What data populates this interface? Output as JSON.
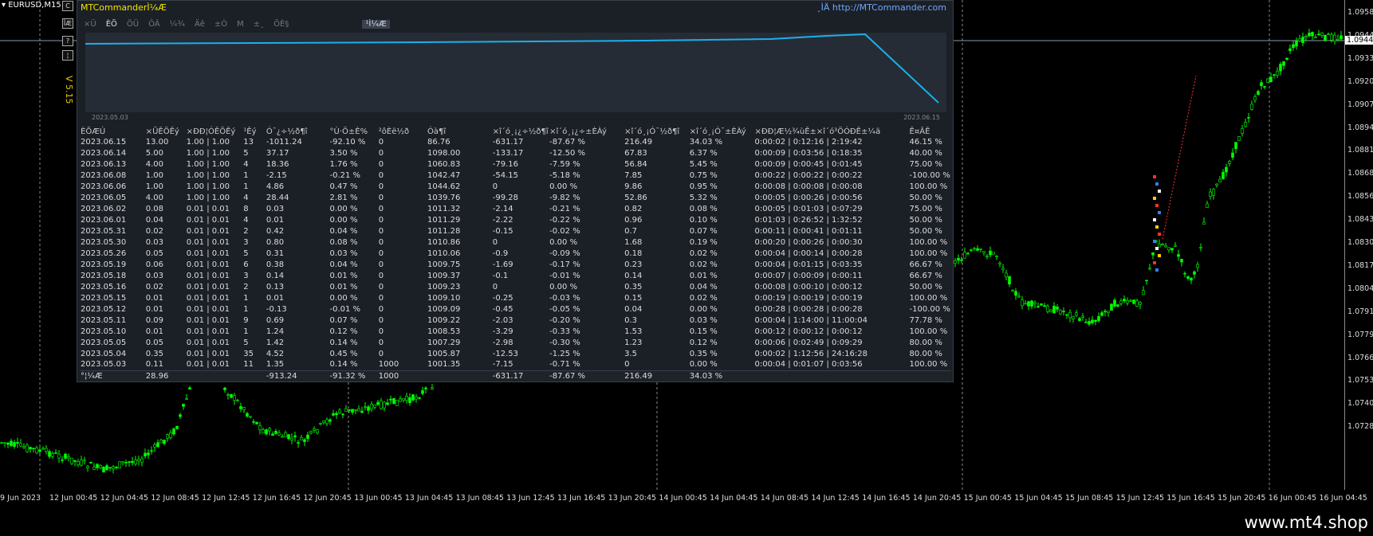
{
  "chart": {
    "symbol": "EURUSD,M15",
    "price_labels": [
      "1.09580",
      "1.09445",
      "1.09335",
      "1.09200",
      "1.09070",
      "1.08940",
      "1.08815",
      "1.08685",
      "1.08560",
      "1.08430",
      "1.08300",
      "1.08175",
      "1.08045",
      "1.07915",
      "1.07790",
      "1.07660",
      "1.07535",
      "1.07405",
      "1.07280"
    ],
    "current_price": "1.09445",
    "time_labels": [
      "9 Jun 2023",
      "12 Jun 00:45",
      "12 Jun 04:45",
      "12 Jun 08:45",
      "12 Jun 12:45",
      "12 Jun 16:45",
      "12 Jun 20:45",
      "13 Jun 00:45",
      "13 Jun 04:45",
      "13 Jun 08:45",
      "13 Jun 12:45",
      "13 Jun 16:45",
      "13 Jun 20:45",
      "14 Jun 00:45",
      "14 Jun 04:45",
      "14 Jun 08:45",
      "14 Jun 12:45",
      "14 Jun 16:45",
      "14 Jun 20:45",
      "15 Jun 00:45",
      "15 Jun 04:45",
      "15 Jun 08:45",
      "15 Jun 12:45",
      "15 Jun 16:45",
      "15 Jun 20:45",
      "16 Jun 00:45",
      "16 Jun 04:45"
    ],
    "candle_color": "#00ff00",
    "current_line_color": "#8a9aaa"
  },
  "sidebar": [
    "C",
    "ÎÆ",
    "?",
    "¦"
  ],
  "panel": {
    "title": "MTCommanderÌ¼Æ",
    "link": "¸ÌÄ http://MTCommander.com",
    "version": "V 5.15",
    "mini_start": "2023.05.03",
    "mini_end": "2023.06.15",
    "mini_color": "#1ab0ee",
    "toolbar": [
      "×Ü",
      "ÈÕ",
      "ÖÜ",
      "ÔÂ",
      "¼¾",
      "Äê",
      "±Ò",
      "M",
      "±¸",
      "ÕÈ§",
      "¹Ì¼Æ"
    ],
    "toolbar_active": 1,
    "toolbar_selected": 10
  },
  "table": {
    "headers": [
      "ÈÕÆÚ",
      "×ÜÊÖÊý",
      "×ÐÐ¦ÓÊÖÊý",
      "¹Êý",
      "Ó¯¿÷½ð¶î",
      "°Ù·Ö±È%",
      "²ôÈë½ð",
      "Óà¶î",
      "×î´ó¸¡¿÷½ð¶î",
      "×î´ó¸¡¿÷±ÈÀý",
      "×î´ó¸¡Ó¯½ð¶î",
      "×î´ó¸¡Ó¯±ÈÀý",
      "×ÐÐ¦Æ½¾ùÊ±×î´ó³ÖÓÐÊ±¼ä",
      "Ê¤ÂÊ"
    ],
    "rows": [
      [
        [
          "2023.06.15",
          ""
        ],
        [
          "13.00",
          "g"
        ],
        [
          "1.00 | 1.00",
          "g"
        ],
        [
          "13",
          "g"
        ],
        [
          "-1011.24",
          "g"
        ],
        [
          "-92.10 %",
          "g"
        ],
        [
          "0",
          ""
        ],
        [
          "86.76",
          ""
        ],
        [
          "-631.17",
          "g"
        ],
        [
          "-87.67 %",
          "g"
        ],
        [
          "216.49",
          "r"
        ],
        [
          "34.03 %",
          "r"
        ],
        [
          "0:00:02 | 0:12:16 | 2:19:42",
          ""
        ],
        [
          "46.15 %",
          ""
        ]
      ],
      [
        [
          "2023.06.14",
          ""
        ],
        [
          "5.00",
          "r"
        ],
        [
          "1.00 | 1.00",
          "r"
        ],
        [
          "5",
          "r"
        ],
        [
          "37.17",
          "r"
        ],
        [
          "3.50 %",
          "r"
        ],
        [
          "0",
          ""
        ],
        [
          "1098.00",
          ""
        ],
        [
          "-133.17",
          "g"
        ],
        [
          "-12.50 %",
          "g"
        ],
        [
          "67.83",
          "r"
        ],
        [
          "6.37 %",
          "r"
        ],
        [
          "0:00:09 | 0:03:56 | 0:18:35",
          ""
        ],
        [
          "40.00 %",
          ""
        ]
      ],
      [
        [
          "2023.06.13",
          ""
        ],
        [
          "4.00",
          "r"
        ],
        [
          "1.00 | 1.00",
          "r"
        ],
        [
          "4",
          "r"
        ],
        [
          "18.36",
          "r"
        ],
        [
          "1.76 %",
          "r"
        ],
        [
          "0",
          ""
        ],
        [
          "1060.83",
          ""
        ],
        [
          "-79.16",
          "g"
        ],
        [
          "-7.59 %",
          "g"
        ],
        [
          "56.84",
          "r"
        ],
        [
          "5.45 %",
          "r"
        ],
        [
          "0:00:09 | 0:00:45 | 0:01:45",
          ""
        ],
        [
          "75.00 %",
          ""
        ]
      ],
      [
        [
          "2023.06.08",
          ""
        ],
        [
          "1.00",
          "g"
        ],
        [
          "1.00 | 1.00",
          "g"
        ],
        [
          "1",
          "g"
        ],
        [
          "-2.15",
          "g"
        ],
        [
          "-0.21 %",
          "g"
        ],
        [
          "0",
          ""
        ],
        [
          "1042.47",
          ""
        ],
        [
          "-54.15",
          "g"
        ],
        [
          "-5.18 %",
          "g"
        ],
        [
          "7.85",
          "r"
        ],
        [
          "0.75 %",
          "r"
        ],
        [
          "0:00:22 | 0:00:22 | 0:00:22",
          ""
        ],
        [
          "-100.00 %",
          ""
        ]
      ],
      [
        [
          "2023.06.06",
          ""
        ],
        [
          "1.00",
          "r"
        ],
        [
          "1.00 | 1.00",
          "r"
        ],
        [
          "1",
          "r"
        ],
        [
          "4.86",
          "r"
        ],
        [
          "0.47 %",
          "r"
        ],
        [
          "0",
          ""
        ],
        [
          "1044.62",
          ""
        ],
        [
          "0",
          ""
        ],
        [
          "0.00 %",
          ""
        ],
        [
          "9.86",
          "r"
        ],
        [
          "0.95 %",
          "r"
        ],
        [
          "0:00:08 | 0:00:08 | 0:00:08",
          ""
        ],
        [
          "100.00 %",
          ""
        ]
      ],
      [
        [
          "2023.06.05",
          ""
        ],
        [
          "4.00",
          "r"
        ],
        [
          "1.00 | 1.00",
          "r"
        ],
        [
          "4",
          "r"
        ],
        [
          "28.44",
          "r"
        ],
        [
          "2.81 %",
          "r"
        ],
        [
          "0",
          ""
        ],
        [
          "1039.76",
          ""
        ],
        [
          "-99.28",
          "g"
        ],
        [
          "-9.82 %",
          "g"
        ],
        [
          "52.86",
          "r"
        ],
        [
          "5.32 %",
          "r"
        ],
        [
          "0:00:05 | 0:00:26 | 0:00:56",
          ""
        ],
        [
          "50.00 %",
          ""
        ]
      ],
      [
        [
          "2023.06.02",
          ""
        ],
        [
          "0.08",
          "r"
        ],
        [
          "0.01 | 0.01",
          "r"
        ],
        [
          "8",
          "r"
        ],
        [
          "0.03",
          "r"
        ],
        [
          "0.00 %",
          "r"
        ],
        [
          "0",
          ""
        ],
        [
          "1011.32",
          ""
        ],
        [
          "-2.14",
          "g"
        ],
        [
          "-0.21 %",
          "g"
        ],
        [
          "0.82",
          "r"
        ],
        [
          "0.08 %",
          "r"
        ],
        [
          "0:00:05 | 0:01:03 | 0:07:29",
          ""
        ],
        [
          "75.00 %",
          ""
        ]
      ],
      [
        [
          "2023.06.01",
          ""
        ],
        [
          "0.04",
          "r"
        ],
        [
          "0.01 | 0.01",
          "r"
        ],
        [
          "4",
          "r"
        ],
        [
          "0.01",
          "r"
        ],
        [
          "0.00 %",
          "r"
        ],
        [
          "0",
          ""
        ],
        [
          "1011.29",
          ""
        ],
        [
          "-2.22",
          "g"
        ],
        [
          "-0.22 %",
          "g"
        ],
        [
          "0.96",
          "r"
        ],
        [
          "0.10 %",
          "r"
        ],
        [
          "0:01:03 | 0:26:52 | 1:32:52",
          ""
        ],
        [
          "50.00 %",
          ""
        ]
      ],
      [
        [
          "2023.05.31",
          ""
        ],
        [
          "0.02",
          "r"
        ],
        [
          "0.01 | 0.01",
          "r"
        ],
        [
          "2",
          "r"
        ],
        [
          "0.42",
          "r"
        ],
        [
          "0.04 %",
          "r"
        ],
        [
          "0",
          ""
        ],
        [
          "1011.28",
          ""
        ],
        [
          "-0.15",
          "g"
        ],
        [
          "-0.02 %",
          "g"
        ],
        [
          "0.7",
          "r"
        ],
        [
          "0.07 %",
          "r"
        ],
        [
          "0:00:11 | 0:00:41 | 0:01:11",
          ""
        ],
        [
          "50.00 %",
          ""
        ]
      ],
      [
        [
          "2023.05.30",
          ""
        ],
        [
          "0.03",
          "r"
        ],
        [
          "0.01 | 0.01",
          "r"
        ],
        [
          "3",
          "r"
        ],
        [
          "0.80",
          "r"
        ],
        [
          "0.08 %",
          "r"
        ],
        [
          "0",
          ""
        ],
        [
          "1010.86",
          ""
        ],
        [
          "0",
          ""
        ],
        [
          "0.00 %",
          ""
        ],
        [
          "1.68",
          "r"
        ],
        [
          "0.19 %",
          "r"
        ],
        [
          "0:00:20 | 0:00:26 | 0:00:30",
          ""
        ],
        [
          "100.00 %",
          ""
        ]
      ],
      [
        [
          "2023.05.26",
          ""
        ],
        [
          "0.05",
          "r"
        ],
        [
          "0.01 | 0.01",
          "r"
        ],
        [
          "5",
          "r"
        ],
        [
          "0.31",
          "r"
        ],
        [
          "0.03 %",
          "r"
        ],
        [
          "0",
          ""
        ],
        [
          "1010.06",
          ""
        ],
        [
          "-0.9",
          "g"
        ],
        [
          "-0.09 %",
          "g"
        ],
        [
          "0.18",
          "r"
        ],
        [
          "0.02 %",
          "r"
        ],
        [
          "0:00:04 | 0:00:14 | 0:00:28",
          ""
        ],
        [
          "100.00 %",
          ""
        ]
      ],
      [
        [
          "2023.05.19",
          ""
        ],
        [
          "0.06",
          "r"
        ],
        [
          "0.01 | 0.01",
          "r"
        ],
        [
          "6",
          "r"
        ],
        [
          "0.38",
          "r"
        ],
        [
          "0.04 %",
          "r"
        ],
        [
          "0",
          ""
        ],
        [
          "1009.75",
          ""
        ],
        [
          "-1.69",
          "g"
        ],
        [
          "-0.17 %",
          "g"
        ],
        [
          "0.23",
          "r"
        ],
        [
          "0.02 %",
          "r"
        ],
        [
          "0:00:04 | 0:01:15 | 0:03:35",
          ""
        ],
        [
          "66.67 %",
          ""
        ]
      ],
      [
        [
          "2023.05.18",
          ""
        ],
        [
          "0.03",
          "r"
        ],
        [
          "0.01 | 0.01",
          "r"
        ],
        [
          "3",
          "r"
        ],
        [
          "0.14",
          "r"
        ],
        [
          "0.01 %",
          "r"
        ],
        [
          "0",
          ""
        ],
        [
          "1009.37",
          ""
        ],
        [
          "-0.1",
          "g"
        ],
        [
          "-0.01 %",
          "g"
        ],
        [
          "0.14",
          "r"
        ],
        [
          "0.01 %",
          "r"
        ],
        [
          "0:00:07 | 0:00:09 | 0:00:11",
          ""
        ],
        [
          "66.67 %",
          ""
        ]
      ],
      [
        [
          "2023.05.16",
          ""
        ],
        [
          "0.02",
          "r"
        ],
        [
          "0.01 | 0.01",
          "r"
        ],
        [
          "2",
          "r"
        ],
        [
          "0.13",
          "r"
        ],
        [
          "0.01 %",
          "r"
        ],
        [
          "0",
          ""
        ],
        [
          "1009.23",
          ""
        ],
        [
          "0",
          ""
        ],
        [
          "0.00 %",
          ""
        ],
        [
          "0.35",
          "r"
        ],
        [
          "0.04 %",
          "r"
        ],
        [
          "0:00:08 | 0:00:10 | 0:00:12",
          ""
        ],
        [
          "50.00 %",
          ""
        ]
      ],
      [
        [
          "2023.05.15",
          ""
        ],
        [
          "0.01",
          "r"
        ],
        [
          "0.01 | 0.01",
          "r"
        ],
        [
          "1",
          "r"
        ],
        [
          "0.01",
          "r"
        ],
        [
          "0.00 %",
          "r"
        ],
        [
          "0",
          ""
        ],
        [
          "1009.10",
          ""
        ],
        [
          "-0.25",
          "g"
        ],
        [
          "-0.03 %",
          "g"
        ],
        [
          "0.15",
          "r"
        ],
        [
          "0.02 %",
          "r"
        ],
        [
          "0:00:19 | 0:00:19 | 0:00:19",
          ""
        ],
        [
          "100.00 %",
          ""
        ]
      ],
      [
        [
          "2023.05.12",
          ""
        ],
        [
          "0.01",
          "g"
        ],
        [
          "0.01 | 0.01",
          "g"
        ],
        [
          "1",
          "g"
        ],
        [
          "-0.13",
          "g"
        ],
        [
          "-0.01 %",
          "g"
        ],
        [
          "0",
          ""
        ],
        [
          "1009.09",
          ""
        ],
        [
          "-0.45",
          "g"
        ],
        [
          "-0.05 %",
          "g"
        ],
        [
          "0.04",
          "r"
        ],
        [
          "0.00 %",
          "r"
        ],
        [
          "0:00:28 | 0:00:28 | 0:00:28",
          ""
        ],
        [
          "-100.00 %",
          ""
        ]
      ],
      [
        [
          "2023.05.11",
          ""
        ],
        [
          "0.09",
          "r"
        ],
        [
          "0.01 | 0.01",
          "r"
        ],
        [
          "9",
          "r"
        ],
        [
          "0.69",
          "r"
        ],
        [
          "0.07 %",
          "r"
        ],
        [
          "0",
          ""
        ],
        [
          "1009.22",
          ""
        ],
        [
          "-2.03",
          "g"
        ],
        [
          "-0.20 %",
          "g"
        ],
        [
          "0.3",
          "r"
        ],
        [
          "0.03 %",
          "r"
        ],
        [
          "0:00:04 | 1:14:00 | 11:00:04",
          ""
        ],
        [
          "77.78 %",
          ""
        ]
      ],
      [
        [
          "2023.05.10",
          ""
        ],
        [
          "0.01",
          "r"
        ],
        [
          "0.01 | 0.01",
          "r"
        ],
        [
          "1",
          "r"
        ],
        [
          "1.24",
          "r"
        ],
        [
          "0.12 %",
          "r"
        ],
        [
          "0",
          ""
        ],
        [
          "1008.53",
          ""
        ],
        [
          "-3.29",
          "g"
        ],
        [
          "-0.33 %",
          "g"
        ],
        [
          "1.53",
          "r"
        ],
        [
          "0.15 %",
          "r"
        ],
        [
          "0:00:12 | 0:00:12 | 0:00:12",
          ""
        ],
        [
          "100.00 %",
          ""
        ]
      ],
      [
        [
          "2023.05.05",
          ""
        ],
        [
          "0.05",
          "r"
        ],
        [
          "0.01 | 0.01",
          "r"
        ],
        [
          "5",
          "r"
        ],
        [
          "1.42",
          "r"
        ],
        [
          "0.14 %",
          "r"
        ],
        [
          "0",
          ""
        ],
        [
          "1007.29",
          ""
        ],
        [
          "-2.98",
          "g"
        ],
        [
          "-0.30 %",
          "g"
        ],
        [
          "1.23",
          "r"
        ],
        [
          "0.12 %",
          "r"
        ],
        [
          "0:00:06 | 0:02:49 | 0:09:29",
          ""
        ],
        [
          "80.00 %",
          ""
        ]
      ],
      [
        [
          "2023.05.04",
          ""
        ],
        [
          "0.35",
          "r"
        ],
        [
          "0.01 | 0.01",
          "r"
        ],
        [
          "35",
          "r"
        ],
        [
          "4.52",
          "r"
        ],
        [
          "0.45 %",
          "r"
        ],
        [
          "0",
          ""
        ],
        [
          "1005.87",
          ""
        ],
        [
          "-12.53",
          "g"
        ],
        [
          "-1.25 %",
          "g"
        ],
        [
          "3.5",
          "r"
        ],
        [
          "0.35 %",
          "r"
        ],
        [
          "0:00:02 | 1:12:56 | 24:16:28",
          ""
        ],
        [
          "80.00 %",
          ""
        ]
      ],
      [
        [
          "2023.05.03",
          ""
        ],
        [
          "0.11",
          "r"
        ],
        [
          "0.01 | 0.01",
          "r"
        ],
        [
          "11",
          "r"
        ],
        [
          "1.35",
          "r"
        ],
        [
          "0.14 %",
          "r"
        ],
        [
          "1000",
          "r"
        ],
        [
          "1001.35",
          ""
        ],
        [
          "-7.15",
          "g"
        ],
        [
          "-0.71 %",
          "g"
        ],
        [
          "0",
          ""
        ],
        [
          "0.00 %",
          ""
        ],
        [
          "0:00:04 | 0:01:07 | 0:03:56",
          ""
        ],
        [
          "100.00 %",
          ""
        ]
      ]
    ],
    "total": [
      [
        "°¦¼Æ",
        ""
      ],
      [
        "28.96",
        "g"
      ],
      [
        "",
        ""
      ],
      [
        "",
        ""
      ],
      [
        "-913.24",
        "g"
      ],
      [
        "-91.32 %",
        "g"
      ],
      [
        "1000",
        "r"
      ],
      [
        "",
        ""
      ],
      [
        "-631.17",
        "g"
      ],
      [
        "-87.67 %",
        "g"
      ],
      [
        "216.49",
        "r"
      ],
      [
        "34.03 %",
        "r"
      ],
      [
        "",
        ""
      ],
      [
        "",
        ""
      ]
    ]
  },
  "watermark": "www.mt4.shop"
}
